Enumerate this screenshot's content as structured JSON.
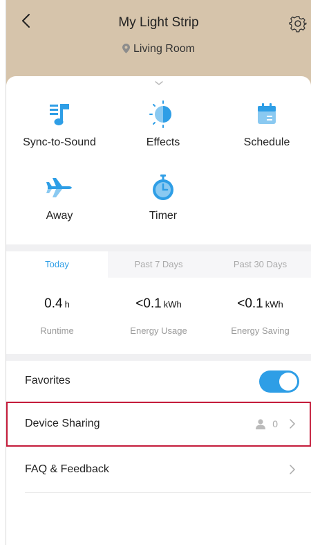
{
  "header": {
    "title": "My Light Strip",
    "location": "Living Room",
    "background": "#d6c4ab"
  },
  "icons": {
    "back": "chevron-left-icon",
    "settings": "gear-icon",
    "location": "map-pin-icon",
    "expand": "chevron-down-icon"
  },
  "features": [
    {
      "label": "Sync-to-Sound",
      "icon": "music-note-icon"
    },
    {
      "label": "Effects",
      "icon": "half-sun-icon"
    },
    {
      "label": "Schedule",
      "icon": "calendar-icon"
    },
    {
      "label": "Away",
      "icon": "airplane-icon"
    },
    {
      "label": "Timer",
      "icon": "stopwatch-icon"
    }
  ],
  "tabs": [
    {
      "label": "Today",
      "active": true
    },
    {
      "label": "Past 7 Days",
      "active": false
    },
    {
      "label": "Past 30 Days",
      "active": false
    }
  ],
  "stats": [
    {
      "value": "0.4",
      "unit": "h",
      "label": "Runtime"
    },
    {
      "value": "<0.1",
      "unit": "kWh",
      "label": "Energy Usage"
    },
    {
      "value": "<0.1",
      "unit": "kWh",
      "label": "Energy Saving"
    }
  ],
  "settings": {
    "favorites": {
      "label": "Favorites",
      "enabled": true
    },
    "device_sharing": {
      "label": "Device Sharing",
      "count": "0"
    },
    "faq": {
      "label": "FAQ & Feedback"
    }
  },
  "colors": {
    "accent": "#2e9ee6",
    "highlight": "#c41c3b"
  }
}
